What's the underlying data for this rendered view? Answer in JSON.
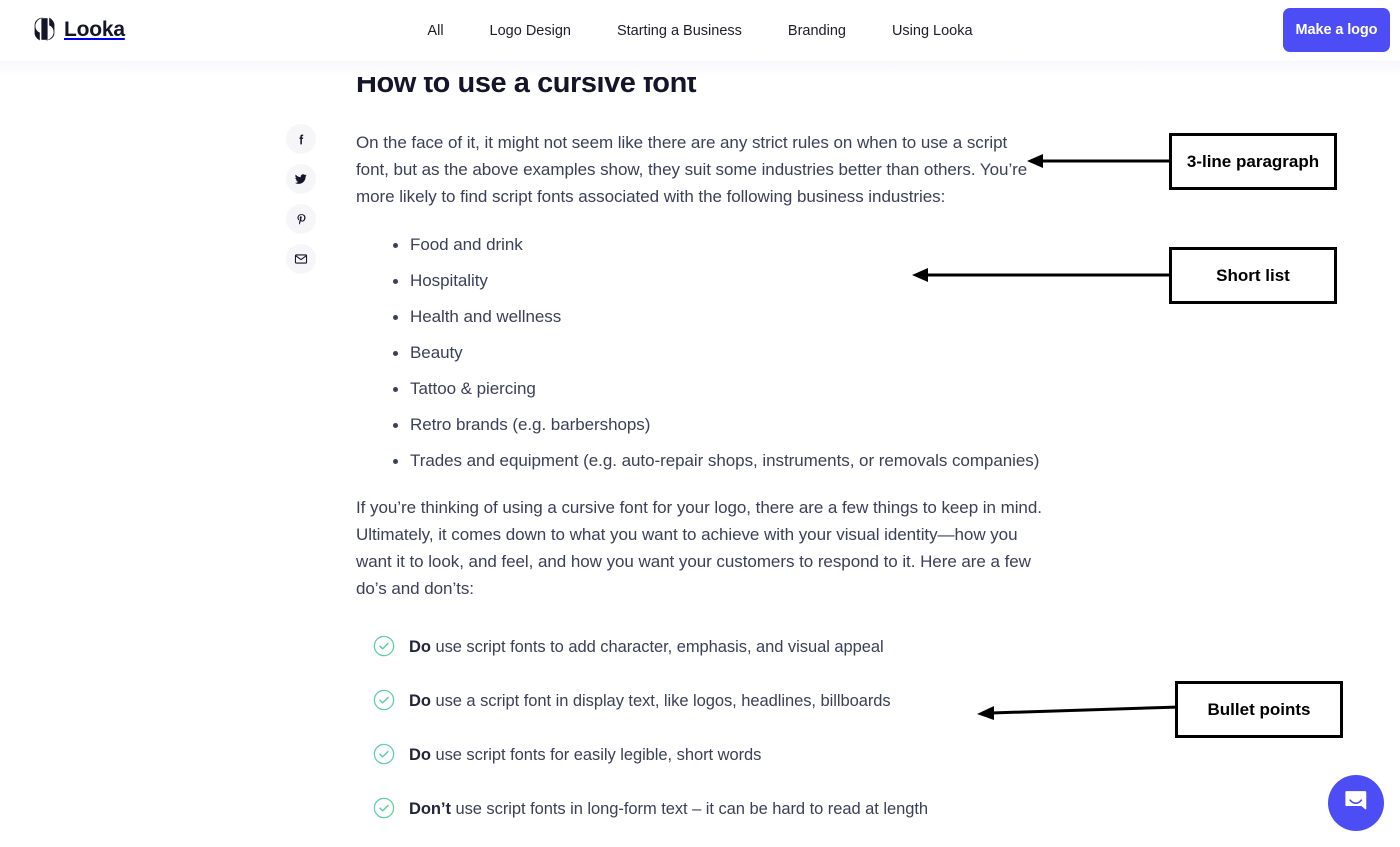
{
  "brand": {
    "name": "Looka",
    "logo_icon": "looka-logo-mark"
  },
  "header": {
    "nav": [
      {
        "label": "All"
      },
      {
        "label": "Logo Design"
      },
      {
        "label": "Starting a Business"
      },
      {
        "label": "Branding"
      },
      {
        "label": "Using Looka"
      }
    ],
    "cta_label": "Make a logo",
    "cta_color": "#4d4df5"
  },
  "share": {
    "items": [
      {
        "icon": "facebook-icon",
        "name": "Facebook"
      },
      {
        "icon": "twitter-icon",
        "name": "Twitter"
      },
      {
        "icon": "pinterest-icon",
        "name": "Pinterest"
      },
      {
        "icon": "email-icon",
        "name": "Email"
      }
    ]
  },
  "article": {
    "title": "How to use a cursive font",
    "intro_paragraph": "On the face of it, it might not seem like there are any strict rules on when to use a script font, but as the above examples show, they suit some industries better than others. You’re more likely to find script fonts associated with the following business industries:",
    "industries": [
      "Food and drink",
      "Hospitality",
      "Health and wellness",
      "Beauty",
      "Tattoo & piercing",
      "Retro brands (e.g. barbershops)",
      "Trades and equipment (e.g. auto-repair shops, instruments, or removals companies)"
    ],
    "second_paragraph": "If you’re thinking of using a cursive font for your logo, there are a few things to keep in mind. Ultimately, it comes down to what you want to achieve with your visual identity—how you want it to look, and feel, and how you want your customers to respond to it. Here are a few do’s and don’ts:",
    "dos_and_donts": [
      {
        "lead": "Do",
        "text": " use script fonts to add character, emphasis, and visual appeal",
        "icon": "check-circle-icon"
      },
      {
        "lead": "Do",
        "text": " use a script font in display text, like logos, headlines, billboards",
        "icon": "check-circle-icon"
      },
      {
        "lead": "Do",
        "text": " use script fonts for easily legible, short words",
        "icon": "check-circle-icon"
      },
      {
        "lead": "Don’t",
        "text": " use script fonts in long-form text – it can be hard to read at length",
        "icon": "check-circle-icon"
      }
    ],
    "check_color": "#5fd0a4",
    "body_color": "#3b4059"
  },
  "annotations": [
    {
      "label": "3-line paragraph",
      "points_to": "intro-paragraph"
    },
    {
      "label": "Short list",
      "points_to": "industry-list"
    },
    {
      "label": "Bullet points",
      "points_to": "dos-and-donts-list"
    }
  ],
  "chat": {
    "icon": "intercom-chat-icon",
    "color": "#4d4df5"
  }
}
